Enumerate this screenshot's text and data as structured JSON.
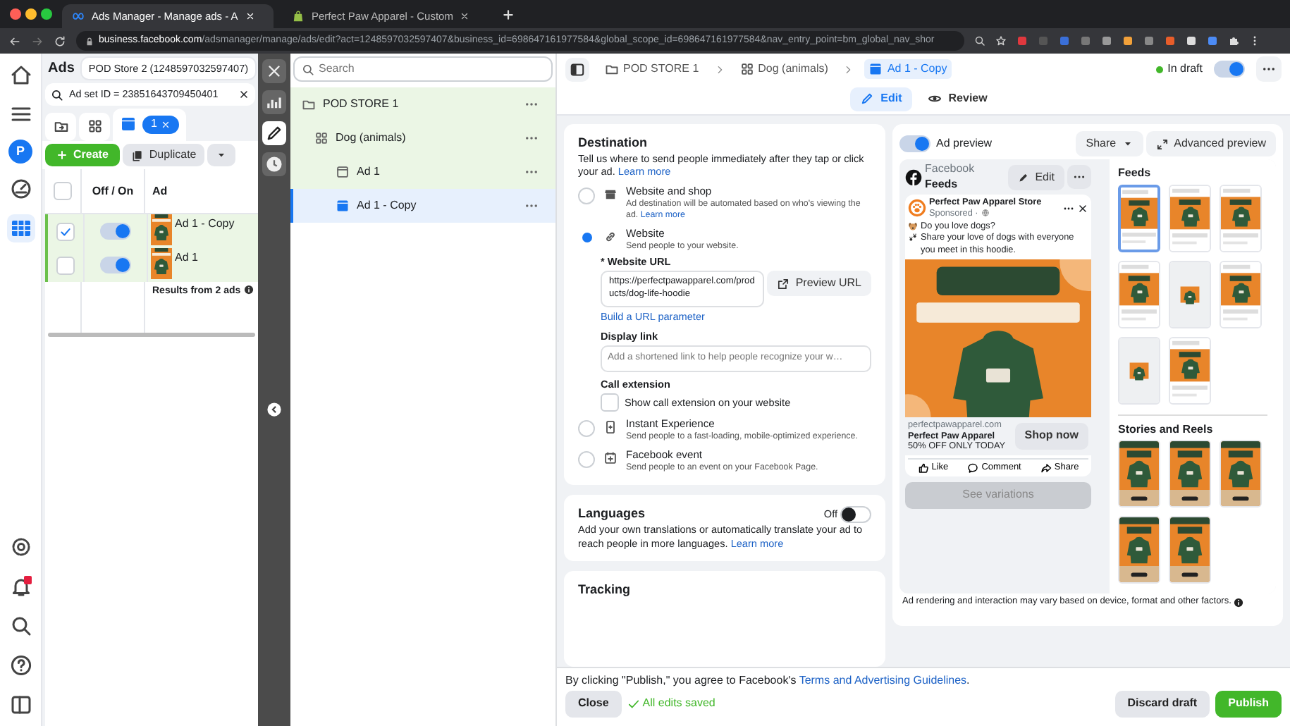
{
  "browser": {
    "tabs": [
      {
        "title": "Ads Manager - Manage ads - A",
        "kind": "meta",
        "selected": true
      },
      {
        "title": "Perfect Paw Apparel - Custom",
        "kind": "store",
        "selected": false
      }
    ],
    "url_host": "business.facebook.com",
    "url_path": "/adsmanager/manage/ads/edit?act=1248597032597407&business_id=698647161977584&global_scope_id=698647161977584&nav_entry_point=bm_global_nav_shor"
  },
  "nav": {
    "avatar": "P"
  },
  "ads_panel": {
    "title": "Ads",
    "account": "POD Store 2 (1248597032597407)",
    "filter": "Ad set ID = 23851643709450401",
    "selected_count": "1",
    "create": "Create",
    "duplicate": "Duplicate",
    "columns": [
      "Off / On",
      "Ad"
    ],
    "rows": [
      {
        "name": "Ad 1 - Copy",
        "checked": true,
        "on": true
      },
      {
        "name": "Ad 1",
        "checked": false,
        "on": true
      }
    ],
    "summary": "Results from 2 ads",
    "select_all_checked": false
  },
  "outline": {
    "search_placeholder": "Search",
    "items": [
      {
        "label": "POD STORE 1",
        "kind": "campaign",
        "selected": false,
        "children": [
          {
            "label": "Dog (animals)",
            "kind": "adset",
            "selected": false,
            "children": [
              {
                "label": "Ad 1",
                "kind": "ad",
                "selected": false
              },
              {
                "label": "Ad 1 - Copy",
                "kind": "ad",
                "selected": true
              }
            ]
          }
        ]
      }
    ]
  },
  "editor": {
    "breadcrumbs": [
      {
        "label": "POD STORE 1",
        "kind": "campaign",
        "selected": false
      },
      {
        "label": "Dog (animals)",
        "kind": "adset",
        "selected": false
      },
      {
        "label": "Ad 1 - Copy",
        "kind": "ad",
        "selected": true
      }
    ],
    "status": "In draft",
    "on": true,
    "modes": [
      {
        "label": "Edit",
        "kind": "edit",
        "selected": true
      },
      {
        "label": "Review",
        "kind": "review",
        "selected": false
      }
    ],
    "destination": {
      "title": "Destination",
      "description": "Tell us where to send people immediately after they tap or click your ad.",
      "link": "Learn more",
      "options": [
        {
          "kind": "shop",
          "title": "Website and shop",
          "description": "Ad destination will be automated based on who's viewing the ad.",
          "link": "Learn more",
          "selected": false
        },
        {
          "kind": "website",
          "title": "Website",
          "description": "Send people to your website.",
          "selected": true
        },
        {
          "kind": "instant",
          "title": "Instant Experience",
          "description": "Send people to a fast-loading, mobile-optimized experience.",
          "selected": false
        },
        {
          "kind": "event",
          "title": "Facebook event",
          "description": "Send people to an event on your Facebook Page.",
          "selected": false
        }
      ],
      "website": {
        "url_label": "* Website URL",
        "url": "https://perfectpawapparel.com/products/dog-life-hoodie",
        "preview_button": "Preview URL",
        "parameter_link": "Build a URL parameter",
        "display_label": "Display link",
        "display_placeholder": "Add a shortened link to help people recognize your w…",
        "call_label": "Call extension",
        "call_checkbox": "Show call extension on your website",
        "call_checked": false
      }
    },
    "languages": {
      "title": "Languages",
      "state": "Off",
      "on": false,
      "description": "Add your own translations or automatically translate your ad to reach people in more languages.",
      "link": "Learn more"
    },
    "tracking": {
      "title": "Tracking"
    },
    "preview": {
      "label": "Ad preview",
      "on": true,
      "share": "Share",
      "advanced": "Advanced preview",
      "platform": "Facebook",
      "placement": "Feeds",
      "edit": "Edit",
      "post": {
        "page": "Perfect Paw Apparel Store",
        "sponsored": "Sponsored ·",
        "lines": [
          {
            "kind": "dog",
            "text": "Do you love dogs?"
          },
          {
            "kind": "paws",
            "text": "Share your love of dogs with everyone you meet in this hoodie."
          }
        ],
        "domain": "perfectpawapparel.com",
        "headline": "Perfect Paw Apparel",
        "description": "50% OFF ONLY TODAY",
        "cta": "Shop now",
        "actions": [
          "Like",
          "Comment",
          "Share"
        ]
      },
      "see_variations": {
        "label": "See variations",
        "disabled": true
      },
      "feeds_title": "Feeds",
      "feeds": [
        {
          "kind": "feed",
          "selected": true
        },
        {
          "kind": "feed",
          "selected": false
        },
        {
          "kind": "feed",
          "selected": false
        },
        {
          "kind": "feed",
          "selected": false
        },
        {
          "kind": "small",
          "selected": false
        },
        {
          "kind": "feed",
          "selected": false
        },
        {
          "kind": "small",
          "selected": false
        },
        {
          "kind": "feed",
          "selected": false
        }
      ],
      "stories_title": "Stories and Reels",
      "stories": [
        {
          "kind": "story",
          "selected": false
        },
        {
          "kind": "story",
          "selected": false
        },
        {
          "kind": "story",
          "selected": false
        },
        {
          "kind": "story",
          "selected": false
        },
        {
          "kind": "story",
          "selected": false
        }
      ],
      "note": "Ad rendering and interaction may vary based on device, format and other factors."
    },
    "footer": {
      "consent": "By clicking \"Publish,\" you agree to Facebook's",
      "consent_link": "Terms and Advertising Guidelines",
      "consent_end": ".",
      "close": "Close",
      "saved": "All edits saved",
      "discard": "Discard draft",
      "publish": "Publish"
    }
  }
}
